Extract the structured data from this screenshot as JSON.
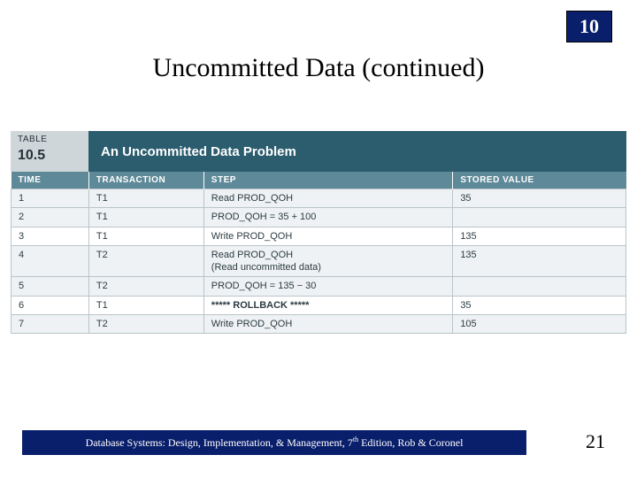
{
  "chapter": "10",
  "title": "Uncommitted Data (continued)",
  "table": {
    "label": "TABLE",
    "number": "10.5",
    "caption": "An Uncommitted Data Problem",
    "headers": [
      "TIME",
      "TRANSACTION",
      "STEP",
      "STORED VALUE"
    ],
    "rows": [
      {
        "time": "1",
        "trans": "T1",
        "step": "Read PROD_QOH",
        "val": "35",
        "hl": false
      },
      {
        "time": "2",
        "trans": "T1",
        "step": "PROD_QOH = 35 + 100",
        "val": "",
        "hl": false
      },
      {
        "time": "3",
        "trans": "T1",
        "step": "Write PROD_QOH",
        "val": "135",
        "hl": true
      },
      {
        "time": "4",
        "trans": "T2",
        "step": "Read PROD_QOH\n(Read uncommitted data)",
        "val": "135",
        "hl": false
      },
      {
        "time": "5",
        "trans": "T2",
        "step": "PROD_QOH = 135 − 30",
        "val": "",
        "hl": false
      },
      {
        "time": "6",
        "trans": "T1",
        "step": "***** ROLLBACK *****",
        "val": "35",
        "hl": true,
        "bold": true
      },
      {
        "time": "7",
        "trans": "T2",
        "step": "Write PROD_QOH",
        "val": "105",
        "hl": false
      }
    ]
  },
  "footer": {
    "text_pre": "Database Systems: Design, Implementation, & Management, 7",
    "sup": "th",
    "text_post": " Edition, Rob & Coronel"
  },
  "page_number": "21"
}
